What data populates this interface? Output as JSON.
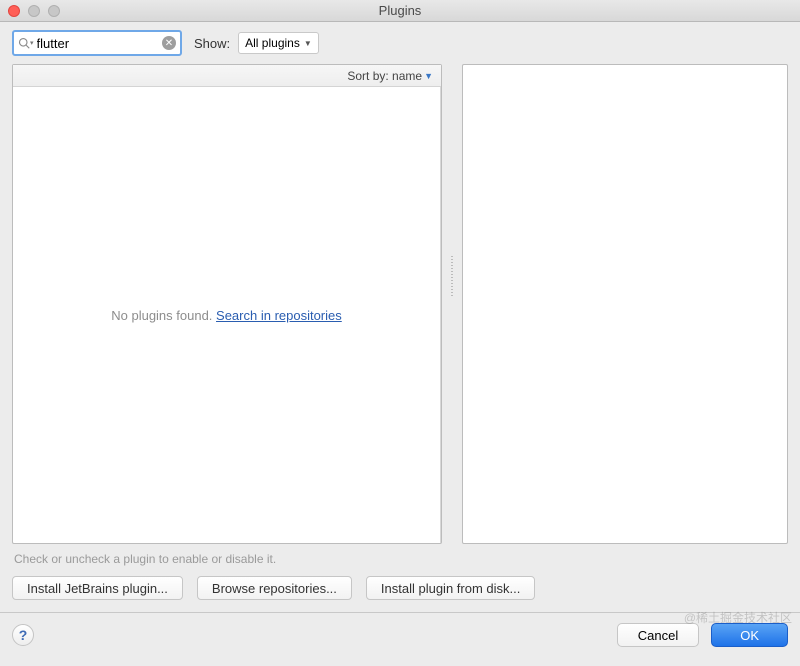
{
  "window": {
    "title": "Plugins"
  },
  "search": {
    "value": "flutter"
  },
  "show": {
    "label": "Show:",
    "selected": "All plugins"
  },
  "sort": {
    "label": "Sort by: name"
  },
  "empty": {
    "text": "No plugins found. ",
    "link": "Search in repositories"
  },
  "hint": "Check or uncheck a plugin to enable or disable it.",
  "buttons": {
    "install_jb": "Install JetBrains plugin...",
    "browse": "Browse repositories...",
    "from_disk": "Install plugin from disk..."
  },
  "footer": {
    "help": "?",
    "cancel": "Cancel",
    "ok": "OK"
  },
  "watermark": "@稀土掘金技术社区"
}
